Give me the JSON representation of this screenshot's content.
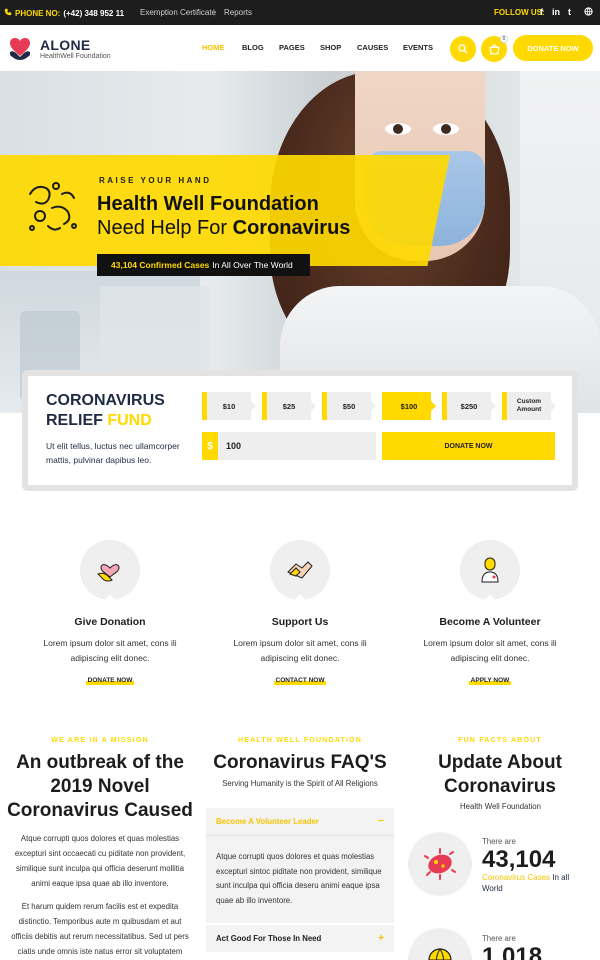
{
  "topbar": {
    "phone_label": "PHONE NO:",
    "phone_number": "(+42) 348 952 11",
    "links": [
      "Exemption Certificate",
      "Reports"
    ],
    "separator": "|",
    "follow_label": "FOLLOW US:",
    "social": [
      {
        "glyph": "f",
        "icon": "facebook-icon"
      },
      {
        "glyph": "in",
        "icon": "linkedin-icon"
      },
      {
        "glyph": "t",
        "icon": "twitter-icon"
      },
      {
        "glyph": "g",
        "icon": "globe-icon"
      }
    ]
  },
  "header": {
    "logo_title": "ALONE",
    "logo_subtitle": "HealthWell Foundation",
    "nav": [
      "HOME",
      "BLOG",
      "PAGES",
      "SHOP",
      "CAUSES",
      "EVENTS"
    ],
    "active_nav": "HOME",
    "cart_count": "0",
    "donate_button": "DONATE NOW",
    "accent": "#ffd900"
  },
  "hero": {
    "eyebrow": "RAISE YOUR HAND",
    "title_line1": "Health Well Foundation",
    "title_line2_prefix": "Need Help For ",
    "title_line2_bold": "Coronavirus",
    "cases_bold": "43,104 Confirmed Cases",
    "cases_rest": "In All Over The World"
  },
  "donation": {
    "title_line1": "CORONAVIRUS",
    "title_line2_prefix": "RELIEF ",
    "title_line2_accent": "FUND",
    "description": "Ut elit tellus, luctus nec ullamcorper mattis, pulvinar dapibus leo.",
    "amounts": [
      "$10",
      "$25",
      "$50",
      "$100",
      "$250",
      "Custom Amount"
    ],
    "selected_amount": "$100",
    "currency_symbol": "$",
    "input_value": "100",
    "submit_label": "DONATE NOW"
  },
  "services": [
    {
      "title": "Give Donation",
      "description": "Lorem ipsum dolor sit amet, cons ili adipiscing elit donec.",
      "link": "DONATE NOW",
      "icon": "heart-hand-icon"
    },
    {
      "title": "Support Us",
      "description": "Lorem ipsum dolor sit amet, cons ili adipiscing elit donec.",
      "link": "CONTACT NOW",
      "icon": "handshake-icon"
    },
    {
      "title": "Become A Volunteer",
      "description": "Lorem ipsum dolor sit amet, cons ili adipiscing elit donec.",
      "link": "APPLY NOW",
      "icon": "volunteer-icon"
    }
  ],
  "mission": {
    "eyebrow": "WE ARE IN A MISSION",
    "heading": "An outbreak of the 2019 Novel Coronavirus Caused",
    "paragraph1": "Atque corrupti quos dolores et quas molestias excepturi sint occaecati cu piditate non provident, similique sunt inculpa qui officia deserunt mollitia animi eaque ipsa quae ab illo inventore.",
    "paragraph2": "Et harum quidem rerum facilis est et expedita distinctio. Temporibus aute m quibusdam et aut officiis debitis aut rerum necessitatibus. Sed ut pers ciatis unde omnis iste natus error sit voluptatem"
  },
  "faq": {
    "eyebrow": "HEALTH WELL FOUNDATION",
    "heading": "Coronavirus FAQ'S",
    "subtitle": "Serving Humanity is the Spirit of All Religions",
    "items": [
      {
        "question": "Become A Volunteer Leader",
        "toggle": "−",
        "answer": "Atque corrupti quos dolores et quas molestias excepturi sintoc piditate non provident, similique sunt inculpa qui officia deseru animi eaque ipsa quae ab illo inventore."
      },
      {
        "question": "Act Good For Those In Need",
        "toggle": "+"
      }
    ]
  },
  "facts": {
    "eyebrow": "FUN FACTS ABOUT",
    "heading": "Update About Coronavirus",
    "subtitle": "Health Well Foundation",
    "items": [
      {
        "prefix": "There are",
        "number": "43,104",
        "label_accent": "Coronavirus Cases",
        "label_rest": "In all World"
      },
      {
        "prefix": "There are",
        "number": "1,018",
        "label_accent": "",
        "label_rest": ""
      }
    ]
  }
}
